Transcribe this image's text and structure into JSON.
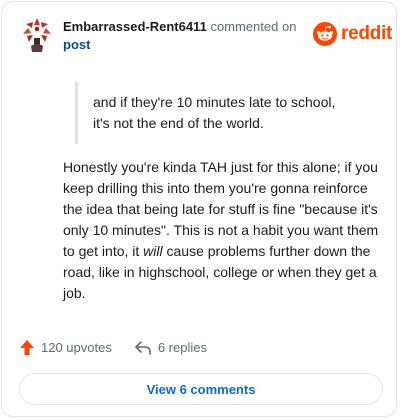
{
  "header": {
    "username": "Embarrassed-Rent6411",
    "commented_on": "commented on",
    "post_link": "post",
    "brand_name": "reddit",
    "brand_color": "#ff4500"
  },
  "quote": {
    "lines": [
      "and if they're 10 minutes late to school,",
      "it's not the end of the world."
    ]
  },
  "comment": {
    "part1": "Honestly you're kinda TAH just for this alone; if you keep drilling this into them you're gonna reinforce the idea that being late for stuff is fine \"because it's only 10 minutes\". This is not a habit you want them to get into, it ",
    "emphasis": "will",
    "part2": " cause problems further down the road, like in highschool, college or when they get a job."
  },
  "actions": {
    "upvotes": "120 upvotes",
    "replies": "6 replies",
    "upvote_icon": "upvote-arrow-icon",
    "reply_icon": "reply-arrow-icon"
  },
  "view_comments": {
    "label": "View 6 comments"
  }
}
